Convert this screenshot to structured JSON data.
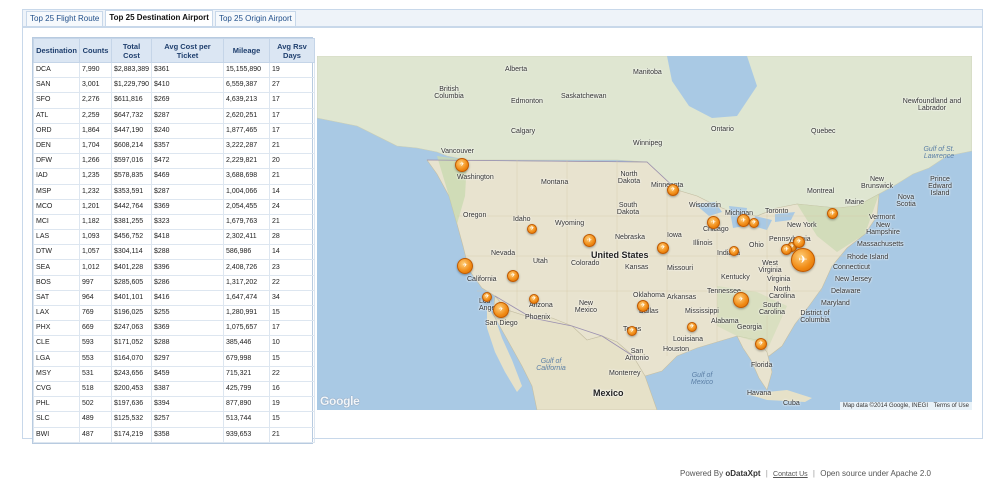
{
  "tabs": [
    {
      "label": "Top 25 Flight Route",
      "active": false
    },
    {
      "label": "Top 25 Destination Airport",
      "active": true
    },
    {
      "label": "Top 25 Origin Airport",
      "active": false
    }
  ],
  "table": {
    "headers": [
      "Destination",
      "Counts",
      "Total Cost",
      "Avg Cost per Ticket",
      "Mileage",
      "Avg Rsv Days"
    ],
    "rows": [
      [
        "DCA",
        "7,990",
        "$2,883,389",
        "$361",
        "15,155,890",
        "19"
      ],
      [
        "SAN",
        "3,001",
        "$1,229,790",
        "$410",
        "6,559,387",
        "27"
      ],
      [
        "SFO",
        "2,276",
        "$611,816",
        "$269",
        "4,639,213",
        "17"
      ],
      [
        "ATL",
        "2,259",
        "$647,732",
        "$287",
        "2,620,251",
        "17"
      ],
      [
        "ORD",
        "1,864",
        "$447,190",
        "$240",
        "1,877,465",
        "17"
      ],
      [
        "DEN",
        "1,704",
        "$608,214",
        "$357",
        "3,222,287",
        "21"
      ],
      [
        "DFW",
        "1,266",
        "$597,016",
        "$472",
        "2,229,821",
        "20"
      ],
      [
        "IAD",
        "1,235",
        "$578,835",
        "$469",
        "3,688,698",
        "21"
      ],
      [
        "MSP",
        "1,232",
        "$353,591",
        "$287",
        "1,004,066",
        "14"
      ],
      [
        "MCO",
        "1,201",
        "$442,764",
        "$369",
        "2,054,455",
        "24"
      ],
      [
        "MCI",
        "1,182",
        "$381,255",
        "$323",
        "1,679,763",
        "21"
      ],
      [
        "LAS",
        "1,093",
        "$456,752",
        "$418",
        "2,302,411",
        "28"
      ],
      [
        "DTW",
        "1,057",
        "$304,114",
        "$288",
        "586,986",
        "14"
      ],
      [
        "SEA",
        "1,012",
        "$401,228",
        "$396",
        "2,408,726",
        "23"
      ],
      [
        "BOS",
        "997",
        "$285,605",
        "$286",
        "1,317,202",
        "22"
      ],
      [
        "SAT",
        "964",
        "$401,101",
        "$416",
        "1,647,474",
        "34"
      ],
      [
        "LAX",
        "769",
        "$196,025",
        "$255",
        "1,280,991",
        "15"
      ],
      [
        "PHX",
        "669",
        "$247,063",
        "$369",
        "1,075,657",
        "17"
      ],
      [
        "CLE",
        "593",
        "$171,052",
        "$288",
        "385,446",
        "10"
      ],
      [
        "LGA",
        "553",
        "$164,070",
        "$297",
        "679,998",
        "15"
      ],
      [
        "MSY",
        "531",
        "$243,656",
        "$459",
        "715,321",
        "22"
      ],
      [
        "CVG",
        "518",
        "$200,453",
        "$387",
        "425,799",
        "16"
      ],
      [
        "PHL",
        "502",
        "$197,636",
        "$394",
        "877,890",
        "19"
      ],
      [
        "SLC",
        "489",
        "$125,532",
        "$257",
        "513,744",
        "15"
      ],
      [
        "BWI",
        "487",
        "$174,219",
        "$358",
        "939,653",
        "21"
      ]
    ]
  },
  "map": {
    "labels": {
      "alberta": "Alberta",
      "manitoba": "Manitoba",
      "british_columbia": "British Columbia",
      "saskatchewan": "Saskatchewan",
      "edmonton": "Edmonton",
      "newfoundland": "Newfoundland and Labrador",
      "calgary": "Calgary",
      "ontario": "Ontario",
      "quebec": "Quebec",
      "winnipeg": "Winnipeg",
      "vancouver": "Vancouver",
      "gulf_st_lawrence": "Gulf of St. Lawrence",
      "washington": "Washington",
      "north_dakota": "North Dakota",
      "montana": "Montana",
      "minnesota": "Minnesota",
      "montreal": "Montreal",
      "new_brunswick": "New Brunswick",
      "prince_edward": "Prince Edward Island",
      "nova_scotia": "Nova Scotia",
      "maine": "Maine",
      "oregon": "Oregon",
      "idaho": "Idaho",
      "south_dakota": "South Dakota",
      "wisconsin": "Wisconsin",
      "michigan": "Michigan",
      "toronto": "Toronto",
      "vermont": "Vermont",
      "new_hampshire": "New Hampshire",
      "wyoming": "Wyoming",
      "new_york": "New York",
      "massachusetts": "Massachusetts",
      "iowa": "Iowa",
      "chicago": "Chicago",
      "nebraska": "Nebraska",
      "illinois": "Illinois",
      "ohio": "Ohio",
      "pennsylvania": "Pennsylvania",
      "rhode_island": "Rhode Island",
      "nevada": "Nevada",
      "utah": "Utah",
      "united_states": "United States",
      "indiana": "Indiana",
      "connecticut": "Connecticut",
      "colorado": "Colorado",
      "kansas": "Kansas",
      "missouri": "Missouri",
      "west_virginia": "West Virginia",
      "california": "California",
      "kentucky": "Kentucky",
      "virginia": "Virginia",
      "new_jersey": "New Jersey",
      "delaware": "Delaware",
      "north_carolina": "North Carolina",
      "maryland": "Maryland",
      "tennessee": "Tennessee",
      "los_angeles": "Los Angeles",
      "oklahoma": "Oklahoma",
      "arkansas": "Arkansas",
      "arizona": "Arizona",
      "new_mexico": "New Mexico",
      "south_carolina": "South Carolina",
      "district_of_columbia": "District of Columbia",
      "phoenix": "Phoenix",
      "dallas": "Dallas",
      "mississippi": "Mississippi",
      "alabama": "Alabama",
      "georgia": "Georgia",
      "san_diego": "San Diego",
      "texas": "Texas",
      "louisiana": "Louisiana",
      "houston": "Houston",
      "san_antonio": "San Antonio",
      "gulf_of_california": "Gulf of California",
      "florida": "Florida",
      "monterrey": "Monterrey",
      "gulf_of_mexico": "Gulf of Mexico",
      "mexico": "Mexico",
      "havana": "Havana",
      "cuba": "Cuba"
    },
    "google_logo": "Google",
    "map_data": "Map data ©2014 Google, INEGI",
    "terms": "Terms of Use",
    "marker_icon": "airplane-icon"
  },
  "footer": {
    "powered_by": "Powered By",
    "brand": "oDataXpt",
    "contact": "Contact Us",
    "license": "Open source under Apache 2.0"
  }
}
